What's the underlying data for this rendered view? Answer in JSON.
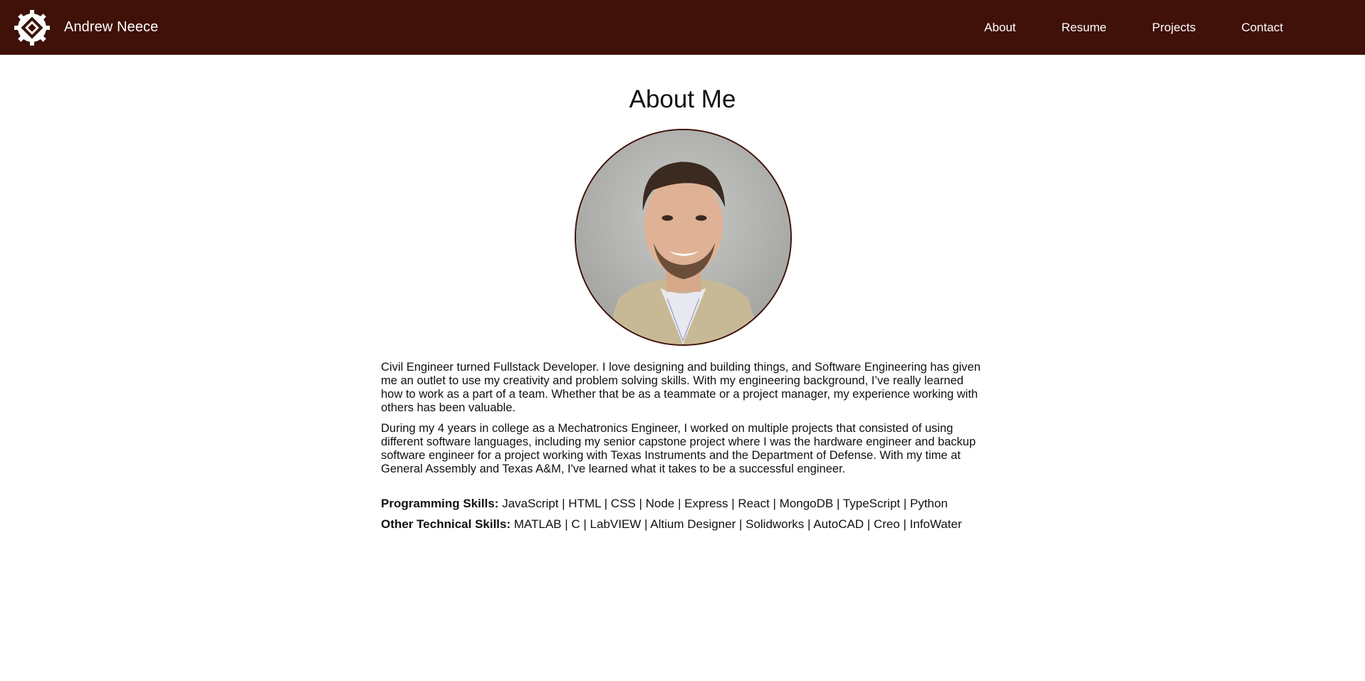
{
  "header": {
    "brand_name": "Andrew Neece",
    "logo_icon": "gear-chip-icon",
    "nav": [
      {
        "label": "About"
      },
      {
        "label": "Resume"
      },
      {
        "label": "Projects"
      },
      {
        "label": "Contact"
      }
    ]
  },
  "about": {
    "title": "About Me",
    "photo_alt": "portrait-photo",
    "paragraphs": [
      "Civil Engineer turned Fullstack Developer. I love designing and building things, and Software Engineering has given me an outlet to use my creativity and problem solving skills. With my engineering background, I’ve really learned how to work as a part of a team. Whether that be as a teammate or a project manager, my experience working with others has been valuable.",
      "During my 4 years in college as a Mechatronics Engineer, I worked on multiple projects that consisted of using different software languages, including my senior capstone project where I was the hardware engineer and backup software engineer for a project working with Texas Instruments and the Department of Defense. With my time at General Assembly and Texas A&M, I've learned what it takes to be a successful engineer."
    ],
    "skills": [
      {
        "label": "Programming Skills:",
        "value": "JavaScript | HTML | CSS | Node | Express | React | MongoDB | TypeScript | Python"
      },
      {
        "label": "Other Technical Skills:",
        "value": "MATLAB | C | LabVIEW | Altium Designer | Solidworks | AutoCAD | Creo | InfoWater"
      }
    ]
  },
  "colors": {
    "navbar_bg": "#3f1108",
    "nav_text": "#ffffff",
    "portrait_border": "#3f1108"
  }
}
